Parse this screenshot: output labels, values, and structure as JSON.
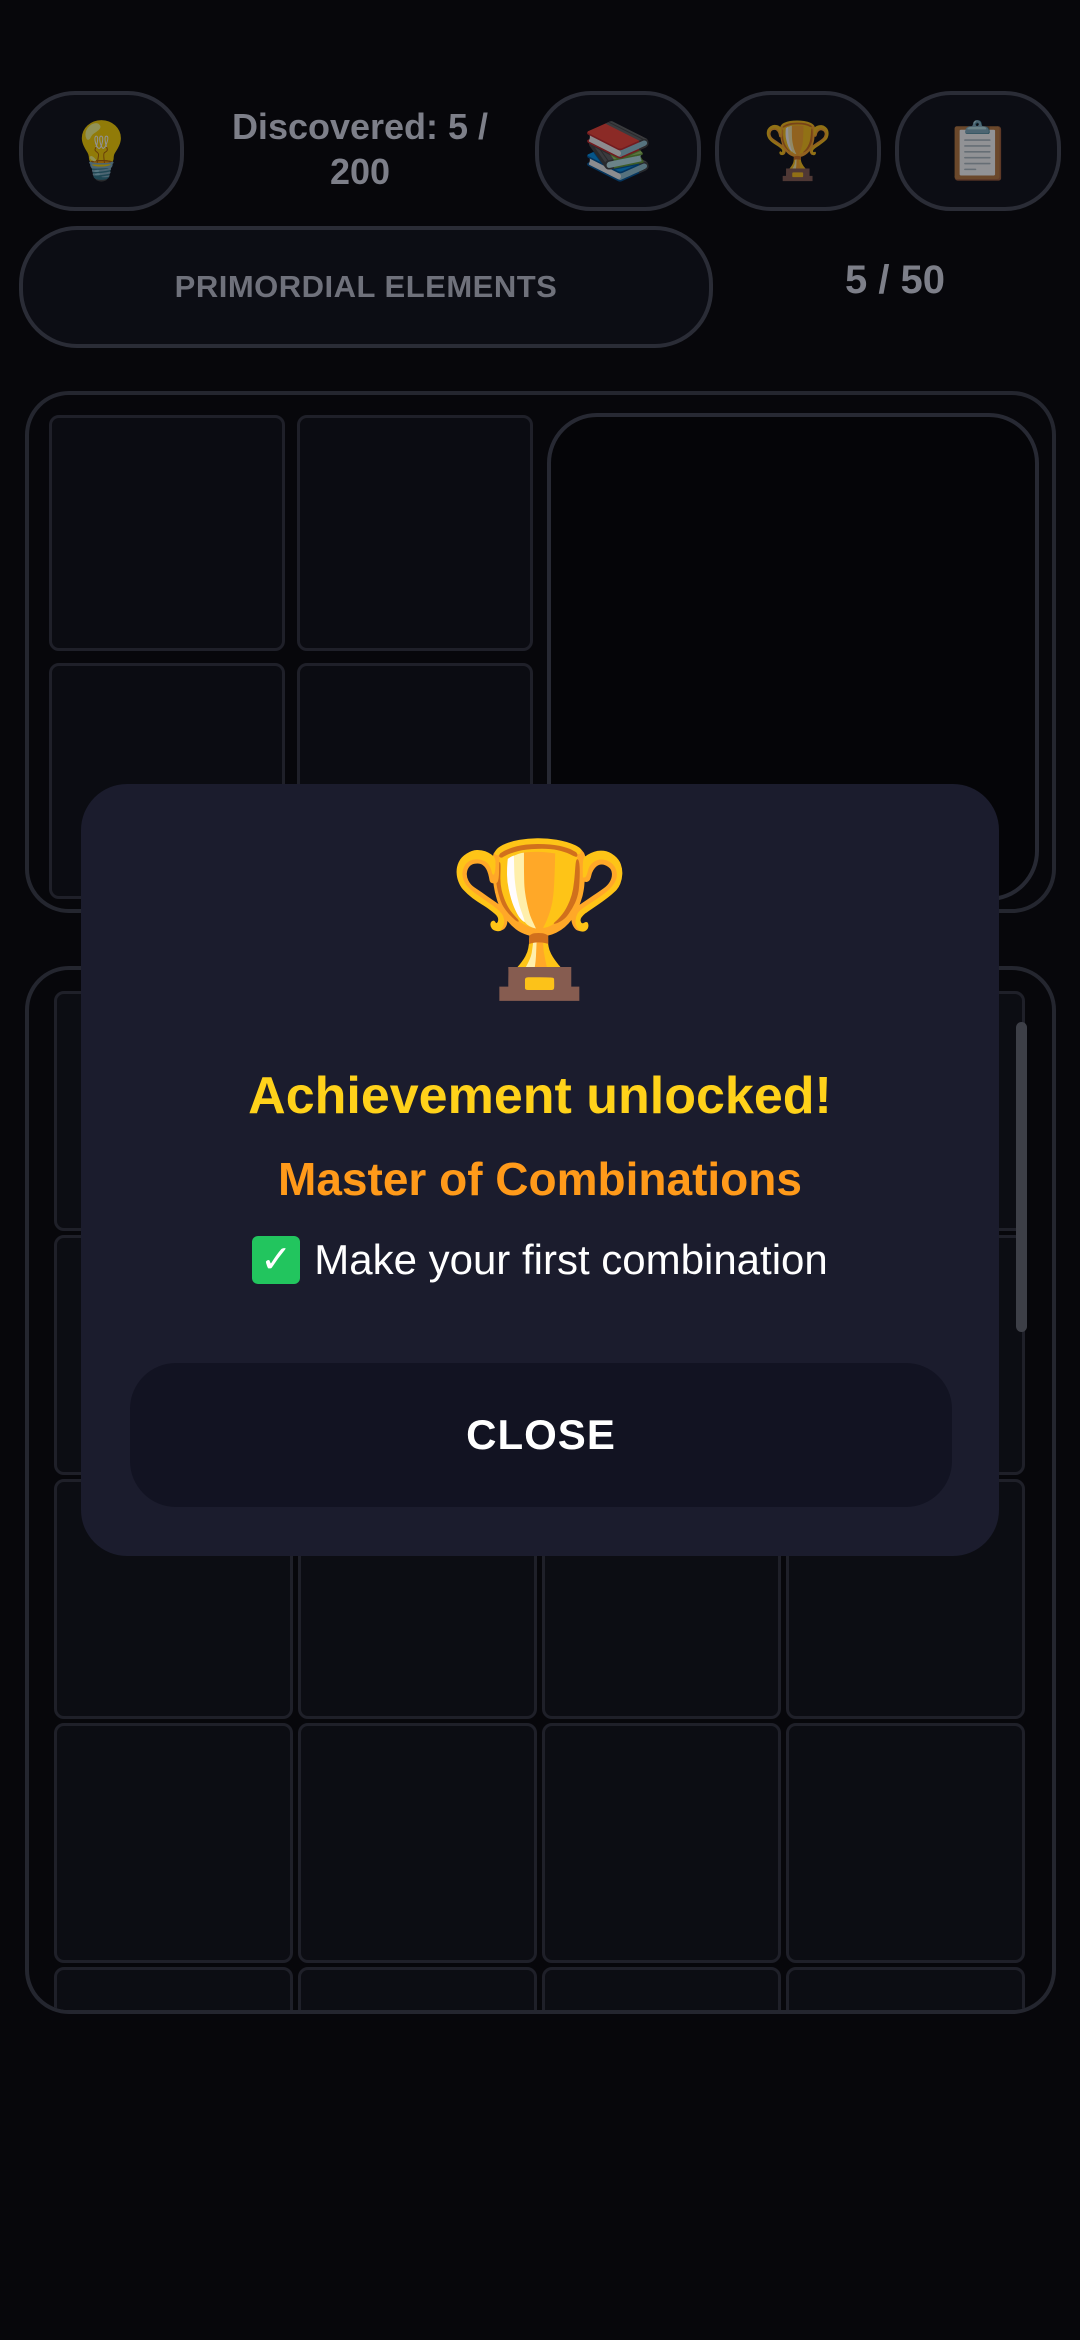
{
  "header": {
    "hint_icon": "lightbulb-icon",
    "discovered_label": "Discovered: 5 /",
    "discovered_total": "200",
    "library_icon": "books-icon",
    "achievements_icon": "trophy-icon",
    "notes_icon": "clipboard-icon"
  },
  "category": {
    "label": "PRIMORDIAL ELEMENTS",
    "count": "5 / 50"
  },
  "modal": {
    "icon": "trophy-icon",
    "title": "Achievement unlocked!",
    "achievement_name": "Master of Combinations",
    "description": "Make your first combination",
    "check_icon": "check-mark-icon",
    "close_label": "CLOSE"
  },
  "colors": {
    "background": "#07070b",
    "modal_bg": "#1b1c2d",
    "title": "#ffd21a",
    "achievement_name": "#ff9a1a",
    "check": "#22c55e"
  }
}
